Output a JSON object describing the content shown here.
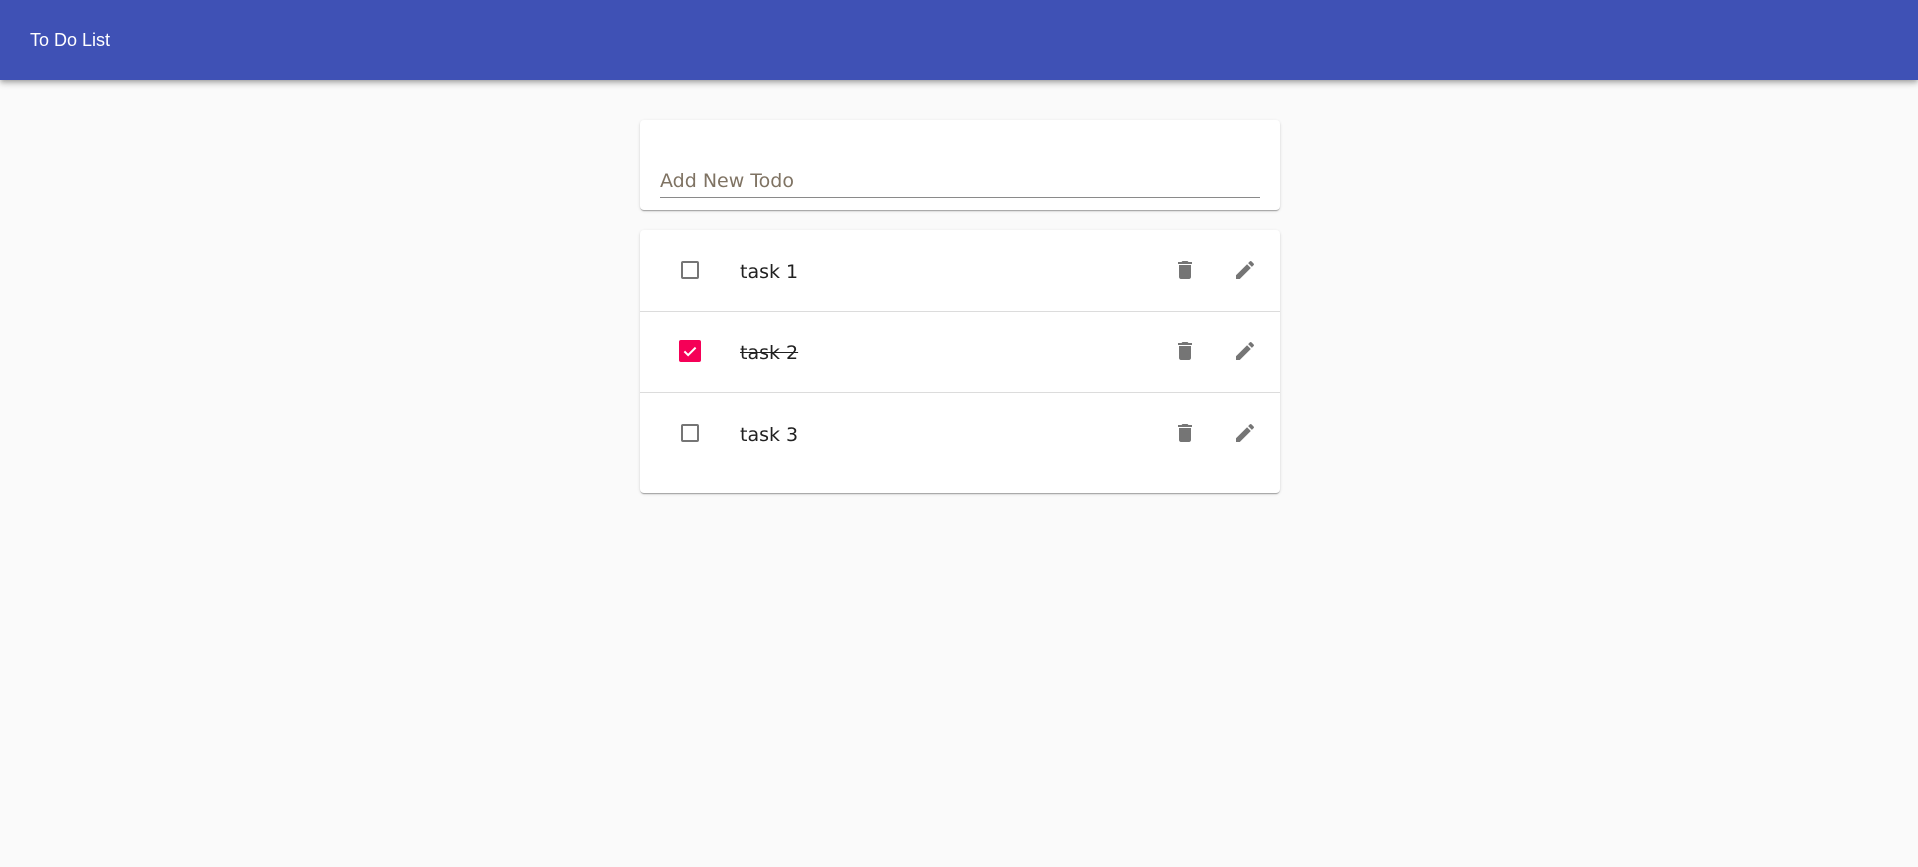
{
  "appbar": {
    "title": "To Do List"
  },
  "new_todo": {
    "placeholder": "Add New Todo",
    "value": ""
  },
  "todos": [
    {
      "label": "task 1",
      "completed": false
    },
    {
      "label": "task 2",
      "completed": true
    },
    {
      "label": "task 3",
      "completed": false
    }
  ],
  "icons": {
    "delete": "trash-icon",
    "edit": "pencil-icon",
    "check": "checkmark-icon"
  },
  "colors": {
    "appbar": "#3f51b5",
    "checkbox_checked": "#f50057",
    "icon": "#757575",
    "background": "#fafafa"
  }
}
